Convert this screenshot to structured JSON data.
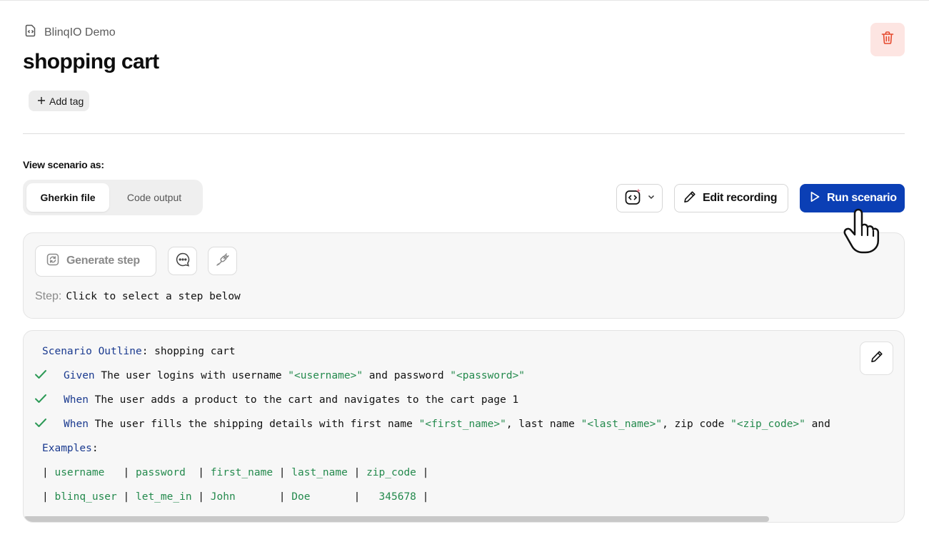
{
  "breadcrumb": {
    "project": "BlinqIO Demo",
    "icon": "file-code-icon"
  },
  "page": {
    "title": "shopping cart",
    "add_tag_label": "Add tag"
  },
  "view": {
    "label": "View scenario as:",
    "options": [
      "Gherkin file",
      "Code output"
    ],
    "selected": "Gherkin file"
  },
  "toolbar": {
    "ai_icon": "ai-code-icon",
    "edit_recording_label": "Edit recording",
    "run_scenario_label": "Run scenario"
  },
  "step_panel": {
    "generate_step_label": "Generate step",
    "step_label": "Step:",
    "step_placeholder": "Click to select a step below"
  },
  "gherkin": {
    "outline_keyword": "Scenario Outline",
    "outline_name": "shopping cart",
    "steps": [
      {
        "status": "passed",
        "keyword": "Given",
        "parts": [
          {
            "t": "The user logins with username ",
            "c": "txt"
          },
          {
            "t": "\"<username>\"",
            "c": "str"
          },
          {
            "t": " and password ",
            "c": "txt"
          },
          {
            "t": "\"<password>\"",
            "c": "str"
          }
        ]
      },
      {
        "status": "passed",
        "keyword": "When",
        "parts": [
          {
            "t": "The user adds a product to the cart and navigates to the cart page 1",
            "c": "txt"
          }
        ]
      },
      {
        "status": "passed",
        "keyword": "When",
        "parts": [
          {
            "t": "The user fills the shipping details with first name ",
            "c": "txt"
          },
          {
            "t": "\"<first_name>\"",
            "c": "str"
          },
          {
            "t": ", last name ",
            "c": "txt"
          },
          {
            "t": "\"<last_name>\"",
            "c": "str"
          },
          {
            "t": ", zip code ",
            "c": "txt"
          },
          {
            "t": "\"<zip_code>\"",
            "c": "str"
          },
          {
            "t": " and",
            "c": "txt"
          }
        ]
      }
    ],
    "examples_keyword": "Examples",
    "table": {
      "headers": [
        "username  ",
        "password ",
        "first_name",
        "last_name",
        "zip_code"
      ],
      "rows": [
        [
          "blinq_user",
          "let_me_in",
          "John      ",
          "Doe      ",
          "  345678"
        ]
      ]
    }
  }
}
